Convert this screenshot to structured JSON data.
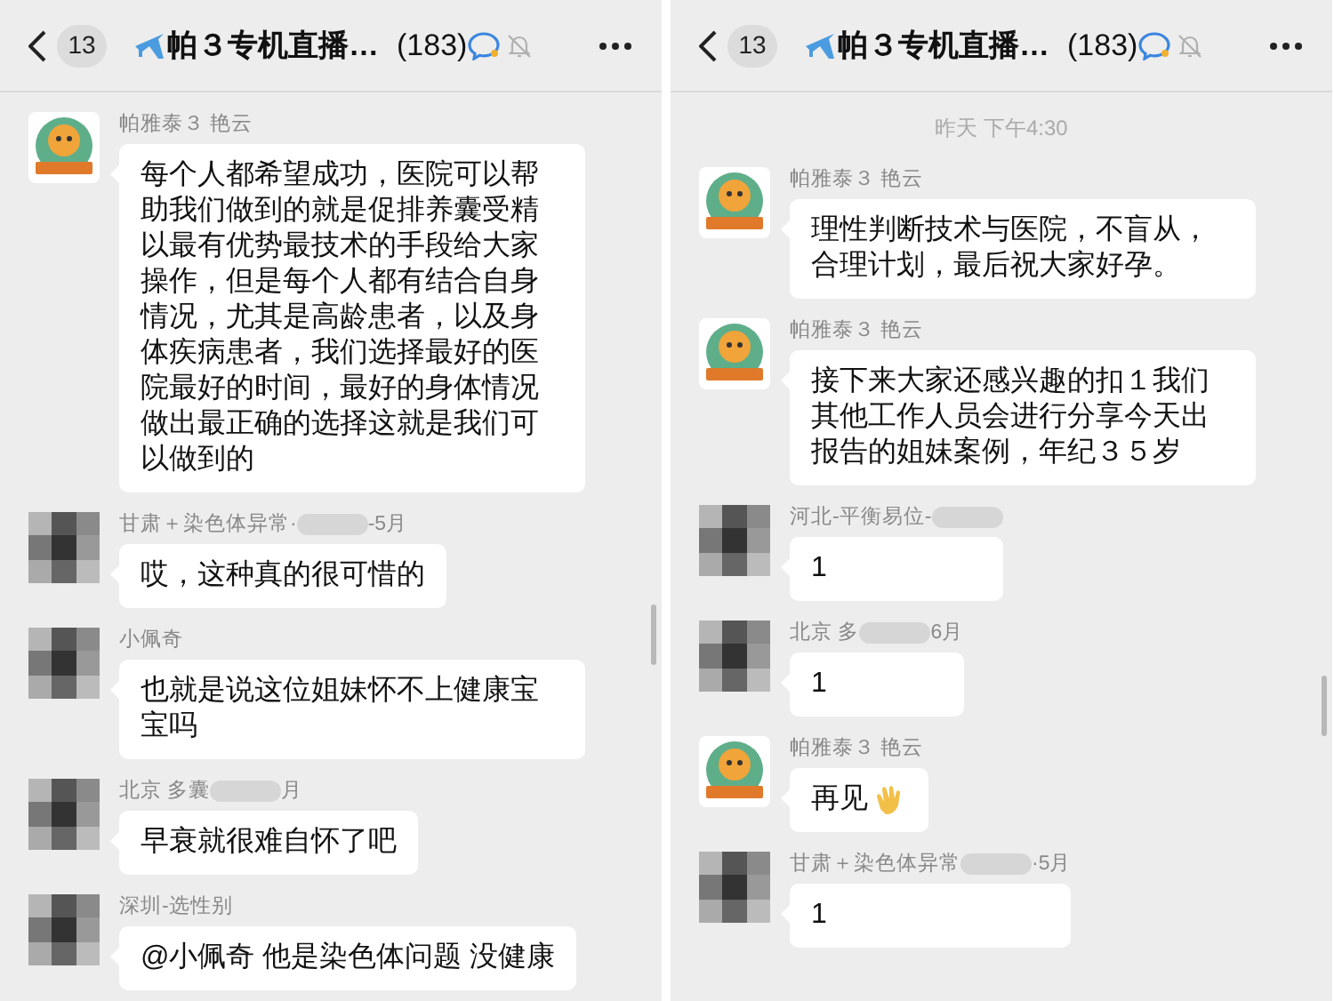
{
  "panels": [
    {
      "header": {
        "unread": "13",
        "title": "帕３专机直播…",
        "member_count": "(183)",
        "muted": true
      },
      "messages": [
        {
          "kind": "mascot",
          "sender": "帕雅泰３ 艳云",
          "redacted": false,
          "text": "每个人都希望成功，医院可以帮助我们做到的就是促排养囊受精以最有优势最技术的手段给大家操作，但是每个人都有结合自身情况，尤其是高龄患者，以及身体疾病患者，我们选择最好的医院最好的时间，最好的身体情况做出最正确的选择这就是我们可以做到的"
        },
        {
          "kind": "pixelated",
          "sender": "甘肃＋染色体异常·",
          "redacted": true,
          "sender_after": "-5月",
          "text": "哎，这种真的很可惜的"
        },
        {
          "kind": "pixelated",
          "sender": "小佩奇",
          "redacted": false,
          "text": "也就是说这位姐妹怀不上健康宝宝吗"
        },
        {
          "kind": "pixelated",
          "sender": "北京 多囊",
          "redacted": true,
          "sender_after": "月",
          "text": "早衰就很难自怀了吧"
        },
        {
          "kind": "pixelated",
          "sender": "深圳-选性别",
          "redacted": false,
          "text": "@小佩奇 他是染色体问题 没健康"
        }
      ]
    },
    {
      "header": {
        "unread": "13",
        "title": "帕３专机直播…",
        "member_count": "(183)",
        "muted": true
      },
      "timestamp": "昨天 下午4:30",
      "messages": [
        {
          "kind": "mascot",
          "sender": "帕雅泰３ 艳云",
          "redacted": false,
          "text": "理性判断技术与医院，不盲从，合理计划，最后祝大家好孕。"
        },
        {
          "kind": "mascot",
          "sender": "帕雅泰３ 艳云",
          "redacted": false,
          "text": "接下来大家还感兴趣的扣１我们其他工作人员会进行分享今天出报告的姐妹案例，年纪３５岁"
        },
        {
          "kind": "pixelated",
          "sender": "河北-平衡易位-",
          "redacted": true,
          "text": "1"
        },
        {
          "kind": "pixelated",
          "sender": "北京 多",
          "redacted": true,
          "sender_after": "6月",
          "text": "1"
        },
        {
          "kind": "mascot",
          "sender": "帕雅泰３ 艳云",
          "redacted": false,
          "text": "再见",
          "wave": true
        },
        {
          "kind": "pixelated",
          "sender": "甘肃＋染色体异常",
          "redacted": true,
          "sender_after": "·5月",
          "text": "1"
        }
      ]
    }
  ]
}
